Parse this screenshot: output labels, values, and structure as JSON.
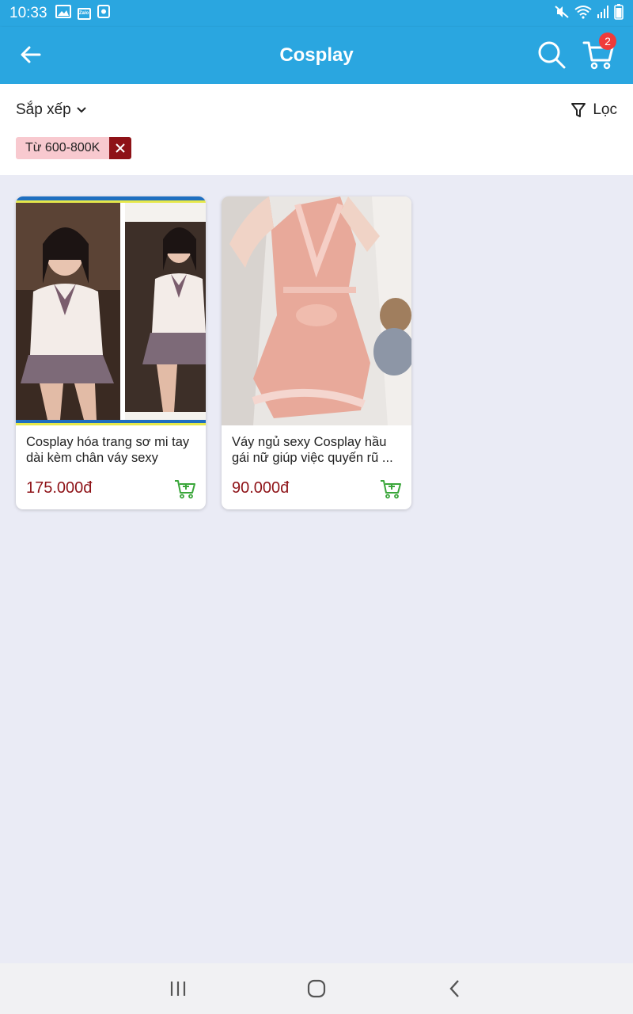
{
  "status_bar": {
    "time": "10:33",
    "zalo_label": "Zalo",
    "icons": [
      "image-icon",
      "zalo-icon",
      "app-icon",
      "mute-icon",
      "wifi-icon",
      "signal-icon",
      "battery-icon"
    ]
  },
  "appbar": {
    "title": "Cosplay",
    "cart_count": "2",
    "color": "#2aa6e0"
  },
  "filters": {
    "sort_label": "Sắp xếp",
    "filter_label": "Lọc",
    "active_chip": "Từ 600-800K"
  },
  "products": [
    {
      "name": "Cosplay hóa trang sơ mi tay dài kèm chân váy sexy",
      "price": "175.000đ"
    },
    {
      "name": "Váy ngủ sexy Cosplay hầu gái nữ giúp việc quyến rũ ...",
      "price": "90.000đ"
    }
  ],
  "colors": {
    "accent": "#2aa6e0",
    "price": "#8e1217",
    "chip_bg": "#f8c9cf",
    "chip_close": "#8e1217",
    "add_cart": "#3aa63a",
    "badge": "#ef3b3b"
  }
}
